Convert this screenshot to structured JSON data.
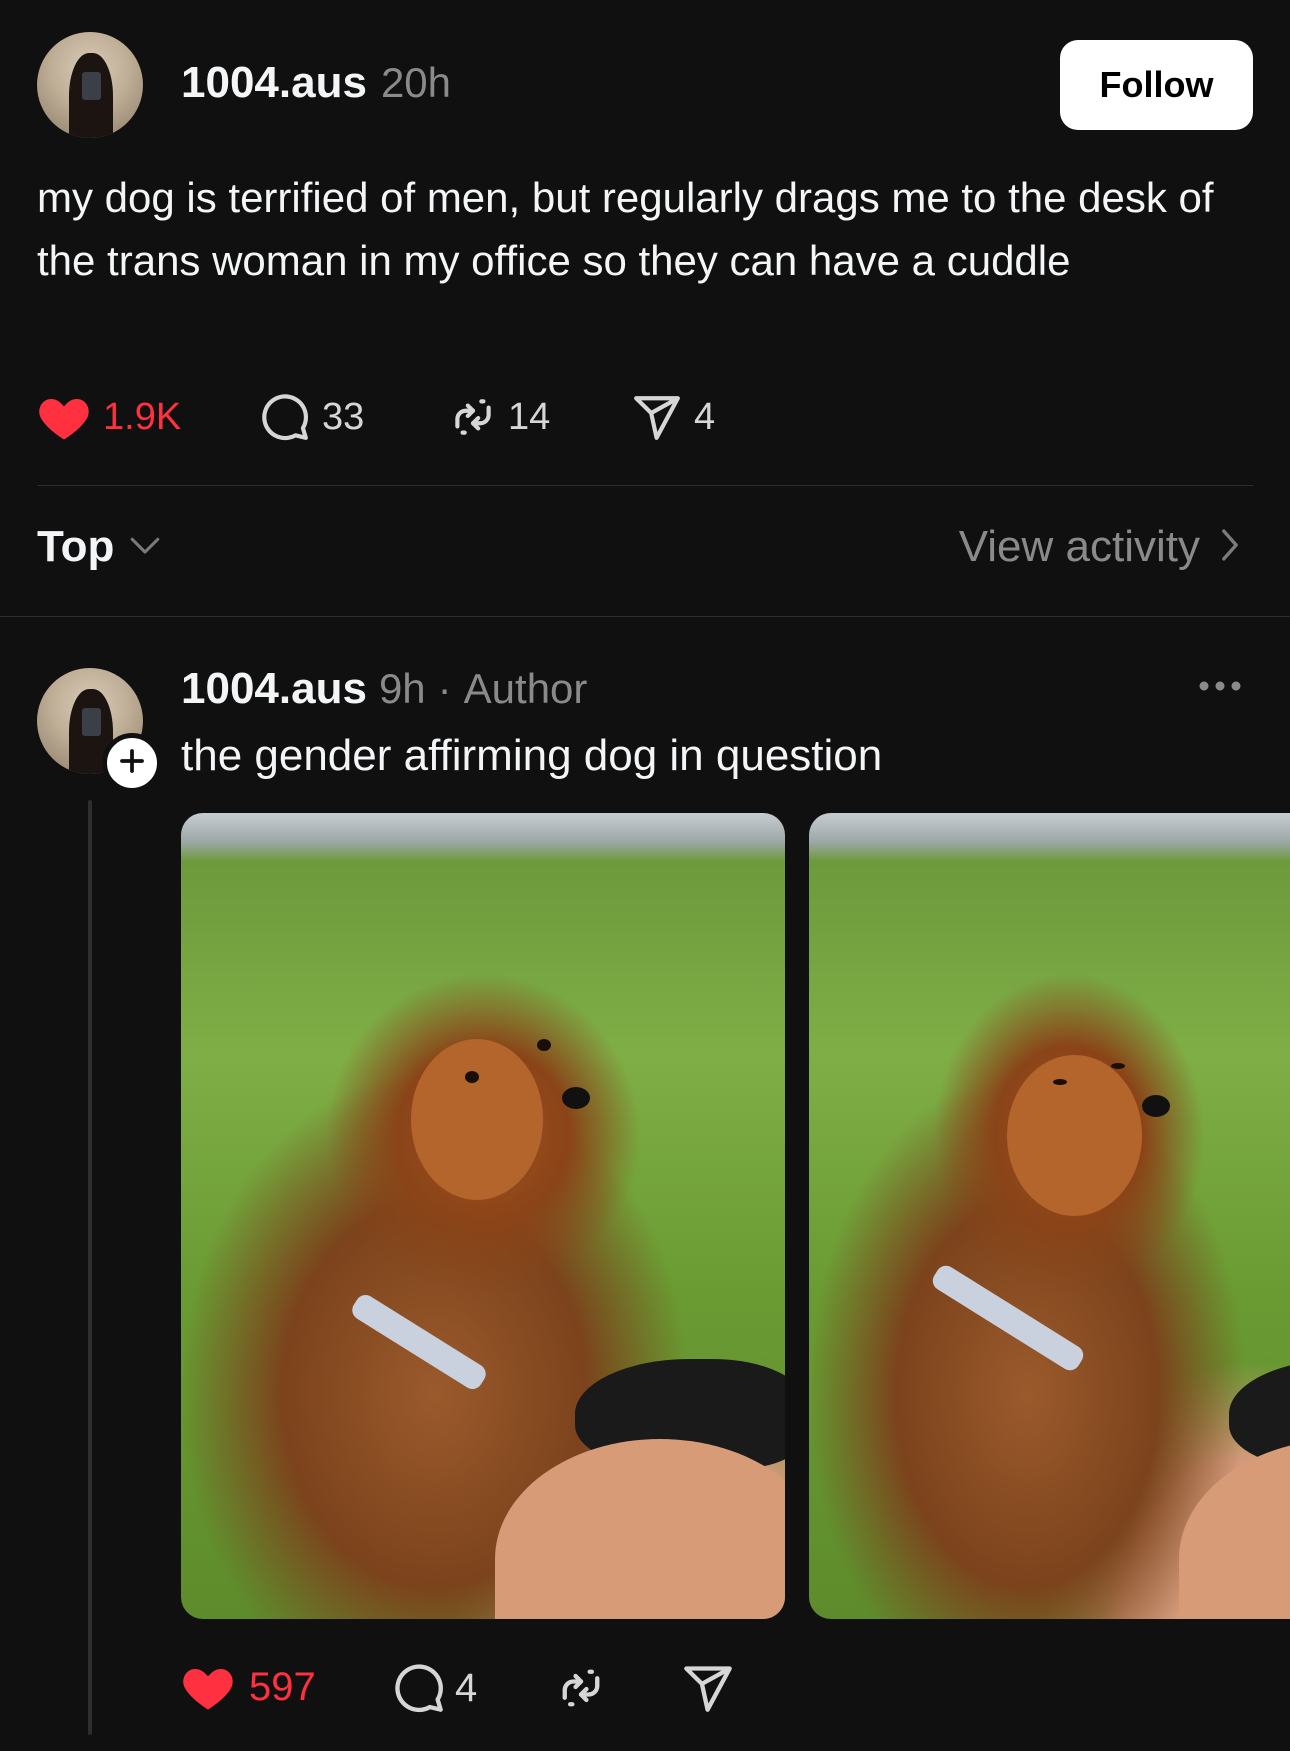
{
  "post": {
    "username": "1004.aus",
    "time": "20h",
    "follow_label": "Follow",
    "text": "my dog is terrified of men, but regularly drags me to the desk of the trans woman in my office so they can have a cuddle",
    "likes": "1.9K",
    "comments": "33",
    "reposts": "14",
    "shares": "4"
  },
  "sort": {
    "label": "Top",
    "view_activity": "View activity"
  },
  "reply": {
    "username": "1004.aus",
    "time": "9h",
    "separator": "·",
    "role": "Author",
    "text": "the gender affirming dog in question",
    "likes": "597",
    "comments": "4"
  },
  "colors": {
    "background": "#101010",
    "text": "#f3f5f7",
    "muted": "#8a8a8a",
    "like_red": "#ff3040",
    "divider": "#2d2d2d"
  },
  "icons": [
    "heart-icon",
    "comment-icon",
    "repost-icon",
    "share-icon",
    "chevron-down-icon",
    "chevron-right-icon",
    "more-icon",
    "plus-icon"
  ]
}
